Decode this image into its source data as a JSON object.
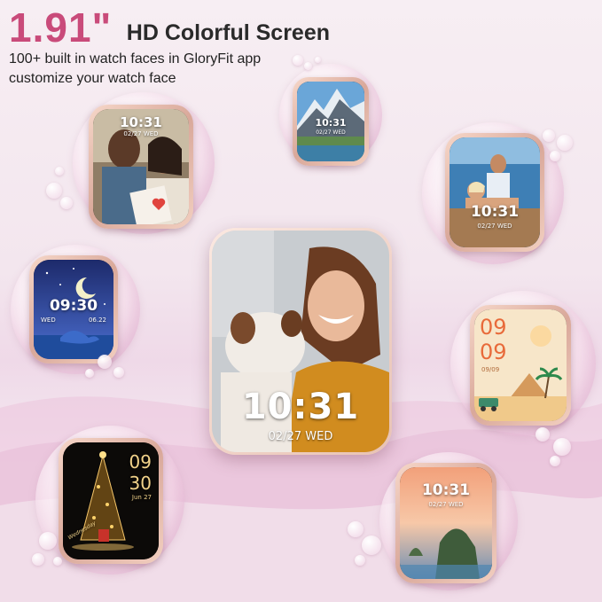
{
  "header": {
    "size": "1.91\"",
    "title": "HD Colorful Screen",
    "line1": "100+ built in watch faces in GloryFit app",
    "line2": "customize your watch face"
  },
  "watch_faces": {
    "family": {
      "time": "10:31",
      "date": "02/27 WED"
    },
    "mountain": {
      "time": "10:31",
      "date": "02/27 WED"
    },
    "couple": {
      "time": "10:31",
      "date": "02/27 WED"
    },
    "night": {
      "time": "09:30",
      "weekday": "WED",
      "date": "06.22"
    },
    "main": {
      "time": "10:31",
      "date": "02/27 WED"
    },
    "desert": {
      "hour": "09",
      "minute": "09",
      "date": "09/09"
    },
    "christmas": {
      "hour": "09",
      "minute": "30",
      "month_day": "Jun 27",
      "script": "Wednesday"
    },
    "cliff": {
      "time": "10:31",
      "date": "02/27 WED"
    }
  },
  "colors": {
    "accent": "#c94b7a",
    "text": "#2a2a2a"
  }
}
